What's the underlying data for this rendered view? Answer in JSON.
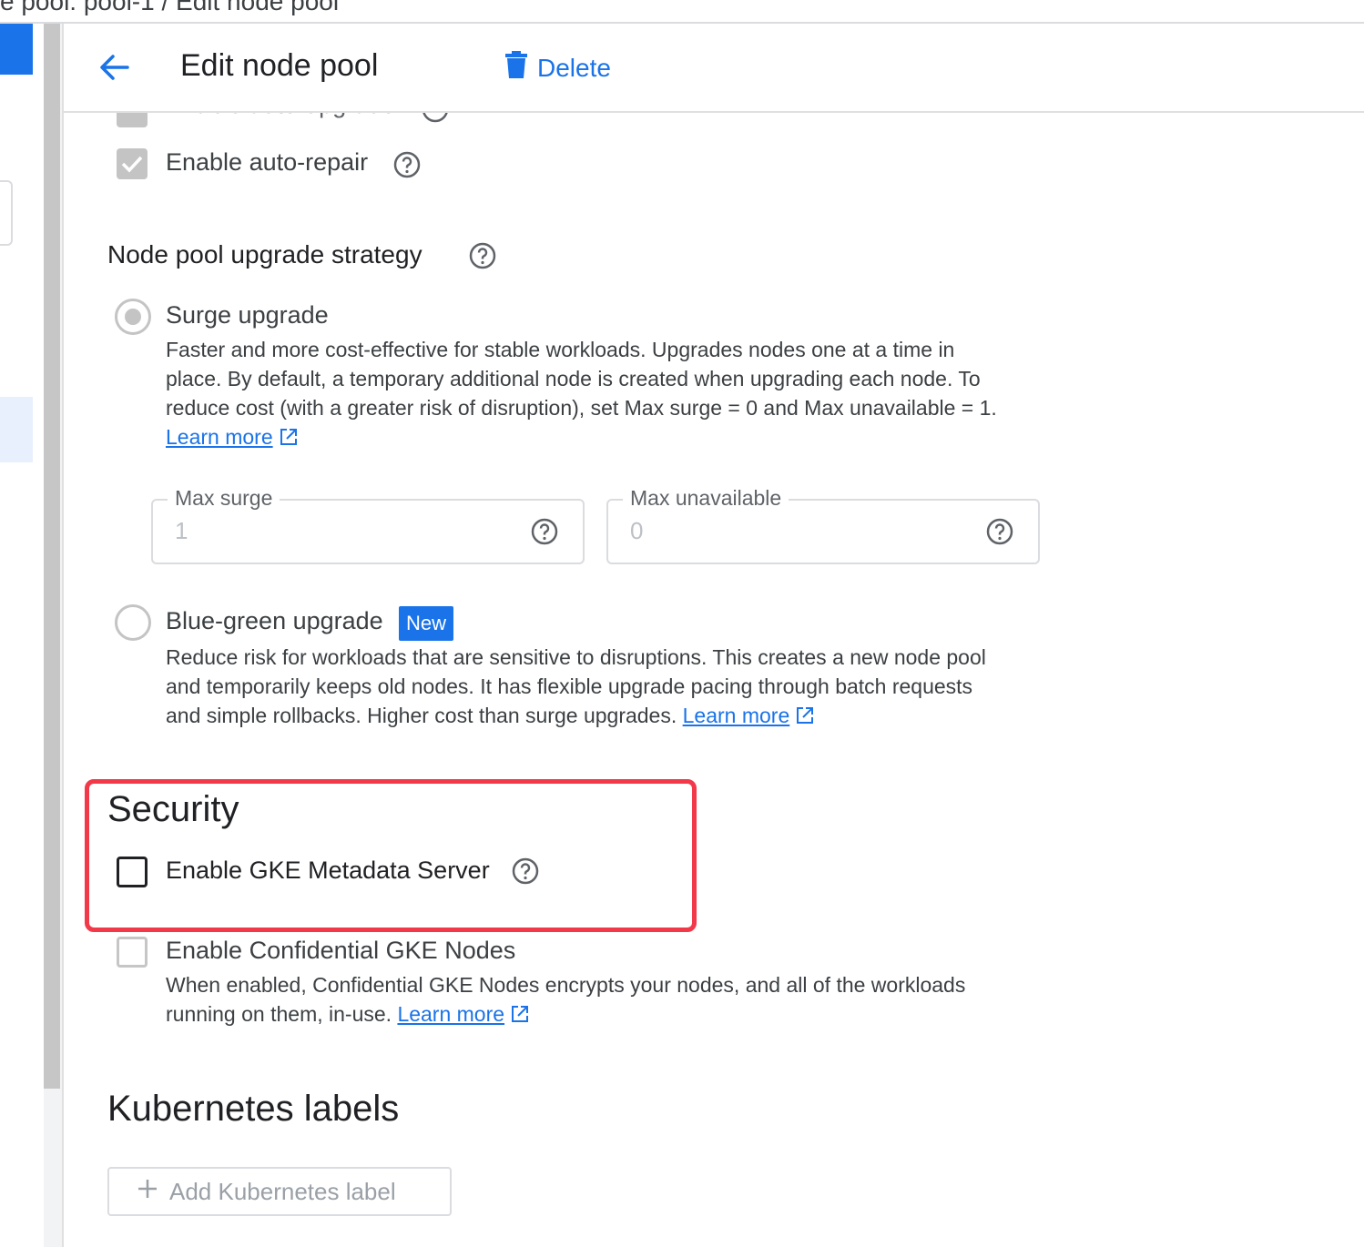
{
  "breadcrumb": {
    "text": "e pool: pool-1  /  Edit node pool"
  },
  "header": {
    "title": "Edit node pool",
    "delete_label": "Delete"
  },
  "colors": {
    "accent": "#1a73e8",
    "highlight_border": "#f2394a",
    "disabled_gray": "#c4c4c4"
  },
  "upgrade": {
    "auto_upgrade_label": "Enable auto-upgrade",
    "auto_repair_label": "Enable auto-repair"
  },
  "strategy": {
    "title": "Node pool upgrade strategy",
    "surge": {
      "label": "Surge upgrade",
      "desc_1": "Faster and more cost-effective for stable workloads. Upgrades nodes one at a time in",
      "desc_2": "place. By default, a temporary additional node is created when upgrading each node. To",
      "desc_3": "reduce cost (with a greater risk of disruption), set Max surge = 0 and Max unavailable = 1.",
      "learn_more": "Learn more",
      "max_surge_label": "Max surge",
      "max_surge_value": "1",
      "max_unavailable_label": "Max unavailable",
      "max_unavailable_value": "0"
    },
    "bluegreen": {
      "label": "Blue-green upgrade",
      "badge": "New",
      "desc_1": "Reduce risk for workloads that are sensitive to disruptions. This creates a new node pool",
      "desc_2": "and temporarily keeps old nodes. It has flexible upgrade pacing through batch requests",
      "desc_3": "and simple rollbacks. Higher cost than surge upgrades.",
      "learn_more": "Learn more"
    }
  },
  "security": {
    "title": "Security",
    "metadata_label": "Enable GKE Metadata Server",
    "confidential_label": "Enable Confidential GKE Nodes",
    "confidential_desc_1": "When enabled, Confidential GKE Nodes encrypts your nodes, and all of the workloads",
    "confidential_desc_2": "running on them, in-use.",
    "learn_more": "Learn more"
  },
  "labels": {
    "title": "Kubernetes labels",
    "add_label": "Add Kubernetes label"
  }
}
